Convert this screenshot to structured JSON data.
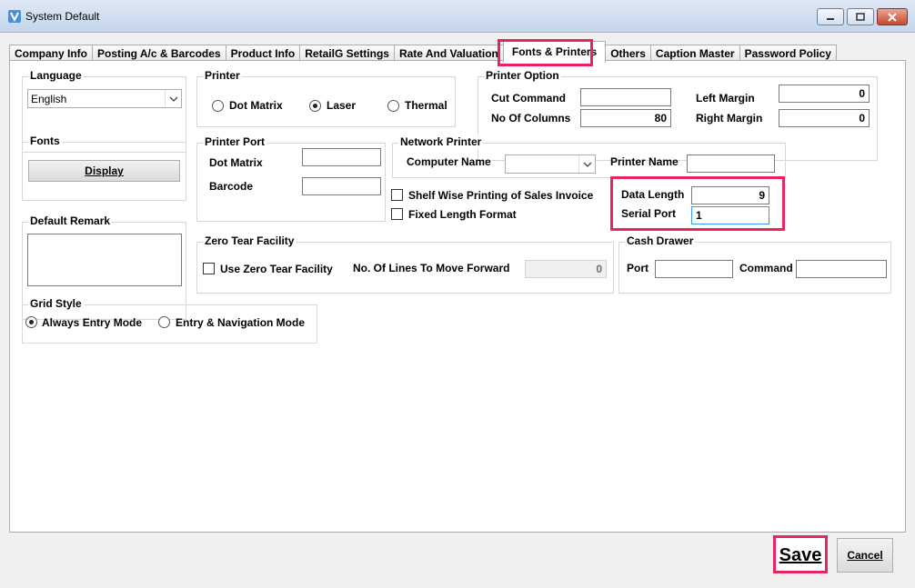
{
  "window": {
    "title": "System Default",
    "icons": {
      "app": "app-icon",
      "minimize": "minimize-icon",
      "maximize": "maximize-icon",
      "close": "close-icon"
    }
  },
  "tabs": [
    {
      "label": "Company Info"
    },
    {
      "label": "Posting A/c & Barcodes"
    },
    {
      "label": "Product Info"
    },
    {
      "label": "RetailG Settings"
    },
    {
      "label": "Rate And Valuation"
    },
    {
      "label": "Fonts & Printers",
      "active": true
    },
    {
      "label": "Others"
    },
    {
      "label": "Caption Master"
    },
    {
      "label": "Password Policy"
    }
  ],
  "language": {
    "title": "Language",
    "selected": "English"
  },
  "printer": {
    "title": "Printer",
    "options": [
      "Dot Matrix",
      "Laser",
      "Thermal"
    ],
    "selected": "Laser"
  },
  "printer_option": {
    "title": "Printer Option",
    "cut_command_label": "Cut Command",
    "cut_command_value": "",
    "no_of_columns_label": "No Of Columns",
    "no_of_columns_value": "80",
    "left_margin_label": "Left Margin",
    "left_margin_value": "0",
    "right_margin_label": "Right Margin",
    "right_margin_value": "0"
  },
  "fonts": {
    "title": "Fonts",
    "display_button": "Display"
  },
  "printer_port": {
    "title": "Printer Port",
    "dot_matrix_label": "Dot Matrix",
    "dot_matrix_value": "",
    "barcode_label": "Barcode",
    "barcode_value": ""
  },
  "network_printer": {
    "title": "Network Printer",
    "computer_name_label": "Computer Name",
    "computer_name_value": "",
    "printer_name_label": "Printer Name",
    "printer_name_value": ""
  },
  "checkboxes": {
    "shelf_wise": {
      "label": "Shelf Wise Printing of Sales Invoice",
      "checked": false
    },
    "fixed_length": {
      "label": "Fixed Length Format",
      "checked": false
    }
  },
  "serial": {
    "data_length_label": "Data Length",
    "data_length_value": "9",
    "serial_port_label": "Serial Port",
    "serial_port_value": "1"
  },
  "default_remark": {
    "title": "Default Remark",
    "value": ""
  },
  "zero_tear": {
    "title": "Zero Tear Facility",
    "use_label": "Use Zero Tear Facility",
    "checked": false,
    "lines_label": "No. Of Lines To Move Forward",
    "lines_value": "0"
  },
  "cash_drawer": {
    "title": "Cash Drawer",
    "port_label": "Port",
    "port_value": "",
    "command_label": "Command",
    "command_value": ""
  },
  "grid_style": {
    "title": "Grid Style",
    "options": [
      "Always Entry Mode",
      "Entry & Navigation Mode"
    ],
    "selected": "Always Entry Mode"
  },
  "buttons": {
    "save": "Save",
    "cancel": "Cancel"
  },
  "colors": {
    "highlight": "#e8255e",
    "titlebar": "#c4d6ec",
    "focus_border": "#3399ff"
  }
}
